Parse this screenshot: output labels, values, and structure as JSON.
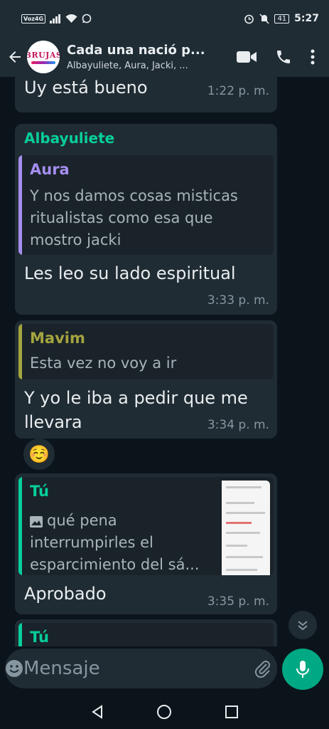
{
  "status_bar": {
    "network_tag": "Voz4G",
    "battery": "41",
    "time": "5:27"
  },
  "header": {
    "avatar_text": "BRUJAS",
    "title": "Cada una nació p...",
    "subtitle": "Albayuliete, Aura, Jacki, ..."
  },
  "messages": [
    {
      "text": "Uy está bueno",
      "time": "1:22 p. m."
    },
    {
      "sender": "Albayuliete",
      "quote_author": "Aura",
      "quote_lines": [
        "Y nos damos cosas misticas",
        "ritualistas como esa que",
        "mostro jacki"
      ],
      "text": "Les leo su lado espiritual",
      "time": "3:33 p. m."
    },
    {
      "quote_author": "Mavim",
      "quote_lines": [
        "Esta vez no voy a ir"
      ],
      "text_lines": [
        "Y yo le iba a pedir que me",
        "llevara"
      ],
      "time": "3:34 p. m."
    },
    {
      "reaction": "☺️"
    },
    {
      "quote_author": "Tú",
      "quote_lines": [
        "qué pena",
        "interrumpirles el",
        "esparcimiento del sá..."
      ],
      "text": "Aprobado",
      "time": "3:35 p. m."
    },
    {
      "quote_author": "Tú"
    }
  ],
  "colors": {
    "aura": "#a58ef0",
    "mavim": "#a4a43f",
    "tu": "#06cf9c",
    "sender_albayuliete": "#06cf9c"
  },
  "input": {
    "placeholder": "Mensaje"
  },
  "icons": [
    "back-arrow-icon",
    "video-call-icon",
    "phone-icon",
    "more-options-icon",
    "emoji-icon",
    "attach-icon",
    "camera-icon",
    "mic-icon",
    "scroll-down-icon",
    "image-icon"
  ]
}
